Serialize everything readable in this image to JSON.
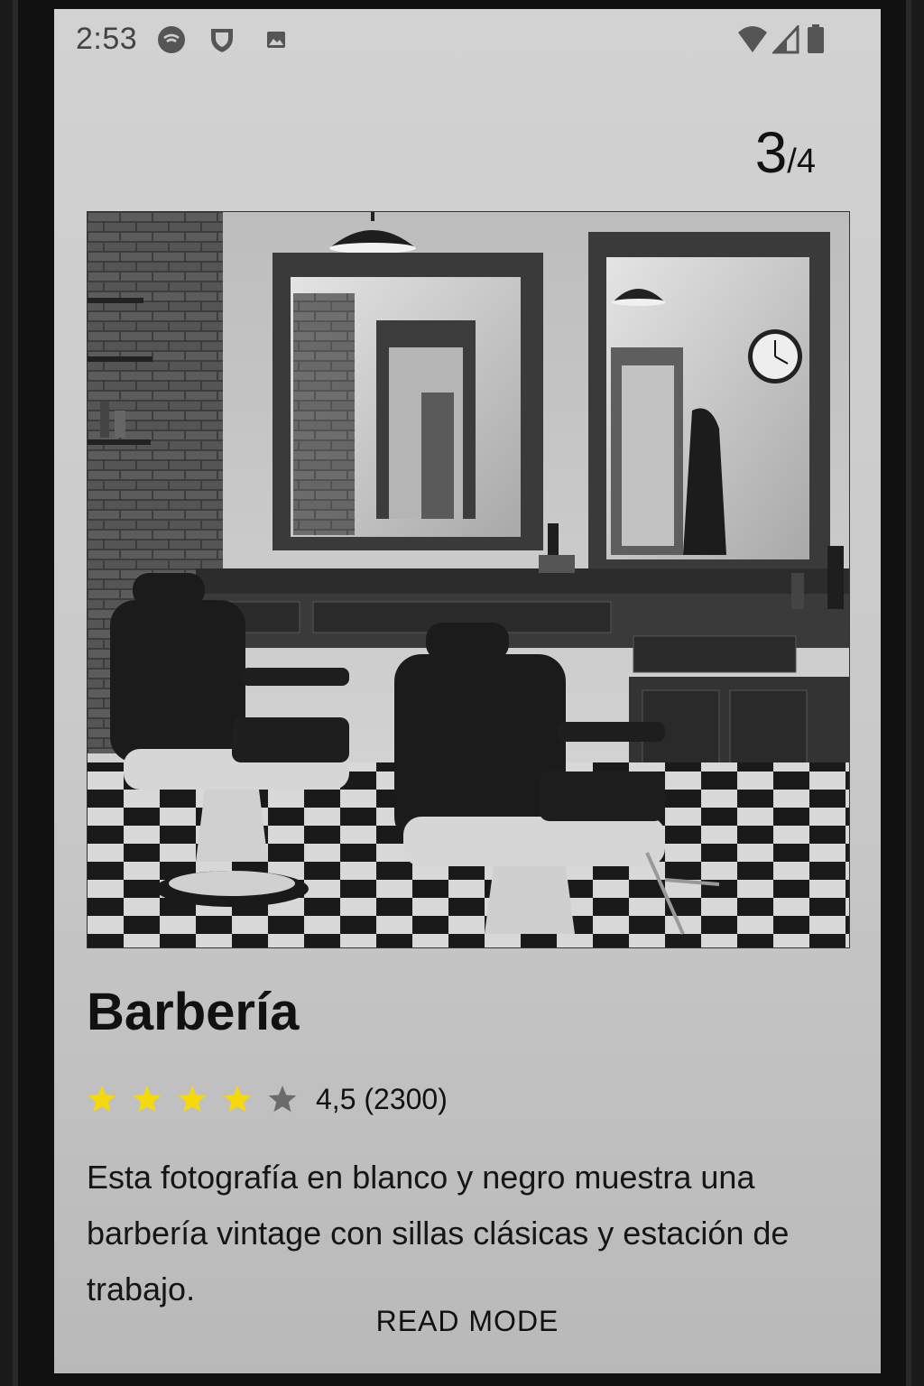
{
  "status_bar": {
    "time": "2:53",
    "left_icons": [
      "hotspot-icon",
      "shield-icon",
      "image-icon"
    ],
    "right_icons": [
      "wifi-icon",
      "cell-signal-icon",
      "battery-icon"
    ]
  },
  "pager": {
    "current": "3",
    "total": "/4"
  },
  "card": {
    "image_alt": "barbershop-photo",
    "title": "Barbería",
    "rating": {
      "stars_filled": 4,
      "stars_total": 5,
      "text": "4,5 (2300)",
      "star_color": "#f5d90a",
      "star_empty_color": "#6b6b6b"
    },
    "description": "Esta fotografía en blanco y negro muestra una barbería vintage con sillas clásicas y estación de trabajo."
  },
  "read_mode_label": "READ MODE"
}
